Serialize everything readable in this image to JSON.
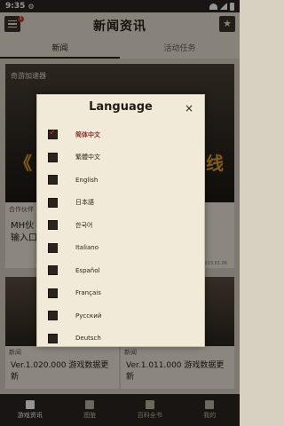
{
  "status_bar": {
    "time": "9:35",
    "gear": "⚙"
  },
  "header": {
    "title": "新闻资讯",
    "notification_count": "1"
  },
  "tabs": [
    {
      "label": "新闻",
      "active": true
    },
    {
      "label": "活动任务",
      "active": false
    }
  ],
  "banner": {
    "tag": "奇游加速器",
    "deco_left": "《",
    "deco_right": "线"
  },
  "card1": {
    "label": "合作伙伴",
    "text": "MH伙\n输入口",
    "date": "2023.01.06"
  },
  "news_cards": [
    {
      "label": "新闻",
      "text": "Ver.1.020.000 游戏数据更新"
    },
    {
      "label": "新闻",
      "text": "Ver.1.011.000 游戏数据更新"
    }
  ],
  "bottom_nav": [
    {
      "label": "游戏资讯",
      "icon": "news-icon",
      "active": true
    },
    {
      "label": "图鉴",
      "icon": "book-icon",
      "active": false
    },
    {
      "label": "百科全书",
      "icon": "encyclopedia-icon",
      "active": false
    },
    {
      "label": "我的",
      "icon": "profile-icon",
      "active": false
    }
  ],
  "dialog": {
    "title": "Language",
    "close_icon": "×",
    "options": [
      {
        "label": "简体中文",
        "checked": true
      },
      {
        "label": "繁體中文",
        "checked": false
      },
      {
        "label": "English",
        "checked": false
      },
      {
        "label": "日本語",
        "checked": false
      },
      {
        "label": "한국어",
        "checked": false
      },
      {
        "label": "Italiano",
        "checked": false
      },
      {
        "label": "Español",
        "checked": false
      },
      {
        "label": "Français",
        "checked": false
      },
      {
        "label": "Русский",
        "checked": false
      },
      {
        "label": "Deutsch",
        "checked": false
      }
    ]
  },
  "colors": {
    "accent": "#8b2a1f",
    "dark": "#2b2520",
    "paper": "#f2ead9"
  }
}
